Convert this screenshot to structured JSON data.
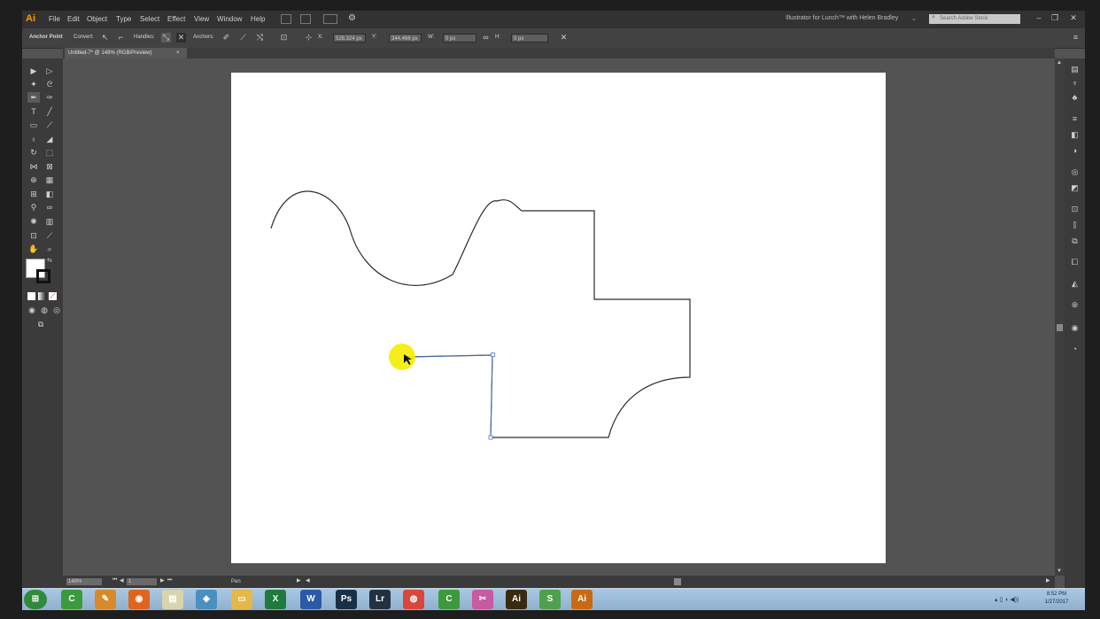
{
  "app": {
    "logo": "Ai",
    "menus": [
      "File",
      "Edit",
      "Object",
      "Type",
      "Select",
      "Effect",
      "View",
      "Window",
      "Help"
    ],
    "workspace_title": "Illustrator for Lunch™ with Helen Bradley",
    "search_placeholder": "Search Adobe Stock",
    "window_controls": [
      "–",
      "❐",
      "✕"
    ]
  },
  "options_bar": {
    "tool_label": "Anchor Point",
    "convert_label": "Convert:",
    "handles_label": "Handles:",
    "anchors_label": "Anchors:",
    "x_label": "X:",
    "x_value": "528.324 px",
    "y_label": "Y:",
    "y_value": "344.466 px",
    "w_label": "W:",
    "w_value": "0 px",
    "h_label": "H:",
    "h_value": "0 px"
  },
  "document": {
    "tab_title": "Untitled-7* @ 148% (RGB/Preview)",
    "tab_close": "×"
  },
  "status_bar": {
    "zoom": "148%",
    "artboard_number": "1",
    "tool_name": "Pen"
  },
  "colors": {
    "accent": "#ff9a00",
    "cursor_highlight": "#f5ec00",
    "selection_blue": "#4a7fd0"
  },
  "taskbar": {
    "items": [
      {
        "icon": "windows-start-icon",
        "color": "#2f8a3c",
        "text": "⊞"
      },
      {
        "icon": "camtasia-icon",
        "color": "#3c9a3c",
        "text": "C"
      },
      {
        "icon": "paint-icon",
        "color": "#d88a2a",
        "text": "✎"
      },
      {
        "icon": "firefox-icon",
        "color": "#e0641c",
        "text": "◉"
      },
      {
        "icon": "notepad-icon",
        "color": "#d9d4b0",
        "text": "▤"
      },
      {
        "icon": "network-icon",
        "color": "#4a8fc0",
        "text": "◈"
      },
      {
        "icon": "file-explorer-icon",
        "color": "#e5b84a",
        "text": "▭"
      },
      {
        "icon": "excel-icon",
        "color": "#1f7a3e",
        "text": "X"
      },
      {
        "icon": "word-icon",
        "color": "#2a5aa8",
        "text": "W"
      },
      {
        "icon": "photoshop-icon",
        "color": "#1a3046",
        "text": "Ps"
      },
      {
        "icon": "lightroom-icon",
        "color": "#23313f",
        "text": "Lr"
      },
      {
        "icon": "chrome-icon",
        "color": "#d9473a",
        "text": "◍"
      },
      {
        "icon": "camtasia-recorder-icon",
        "color": "#3c9a3c",
        "text": "C"
      },
      {
        "icon": "snipping-tool-icon",
        "color": "#c75aa0",
        "text": "✂"
      },
      {
        "icon": "illustrator-icon",
        "color": "#3a2a12",
        "text": "Ai"
      },
      {
        "icon": "snagit-icon",
        "color": "#4fa04a",
        "text": "S"
      },
      {
        "icon": "illustrator-icon",
        "color": "#c96a12",
        "text": "Ai"
      }
    ],
    "time": "8:52 PM",
    "date": "1/27/2017"
  }
}
